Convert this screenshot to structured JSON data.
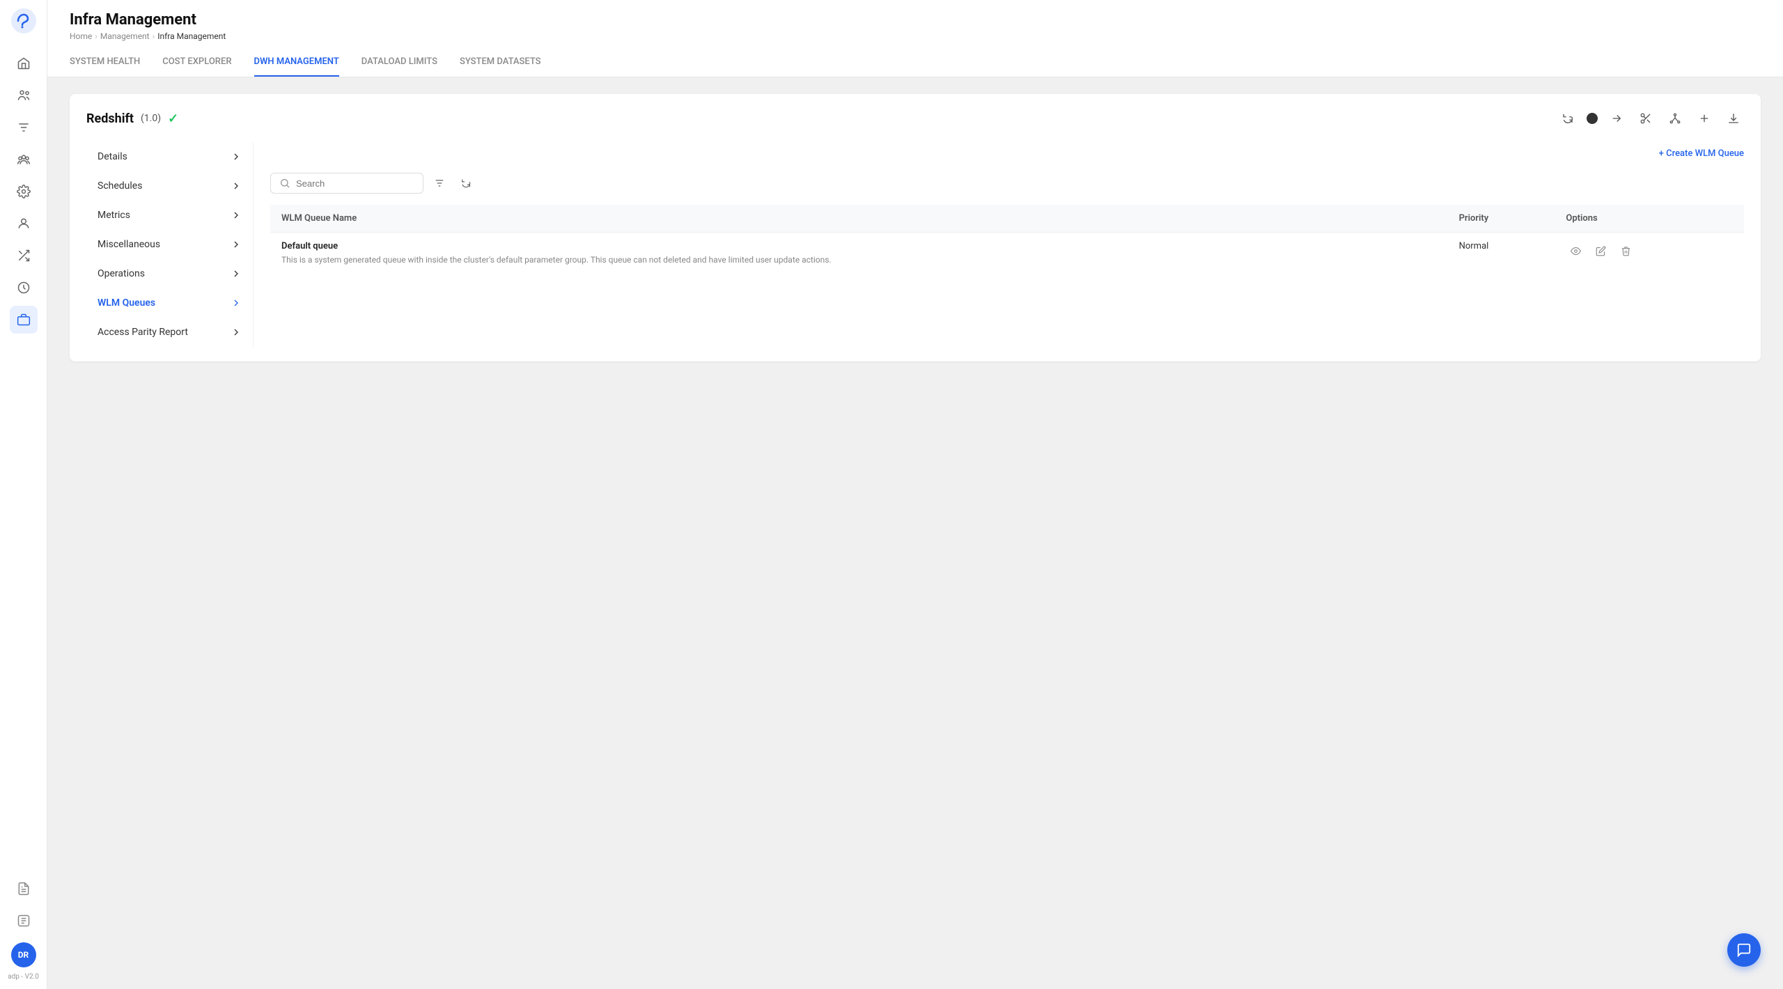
{
  "app": {
    "logo_alt": "App Logo",
    "version_label": "adp - V2.0"
  },
  "header": {
    "title": "Infra Management",
    "breadcrumb": [
      "Home",
      "Management",
      "Infra Management"
    ],
    "tabs": [
      {
        "label": "SYSTEM HEALTH",
        "active": false
      },
      {
        "label": "COST EXPLORER",
        "active": false
      },
      {
        "label": "DWH MANAGEMENT",
        "active": true
      },
      {
        "label": "DATALOAD LIMITS",
        "active": false
      },
      {
        "label": "SYSTEM DATASETS",
        "active": false
      }
    ]
  },
  "card": {
    "title": "Redshift",
    "version": "(1.0)",
    "check_symbol": "✓"
  },
  "left_nav": {
    "items": [
      {
        "label": "Details",
        "active": false
      },
      {
        "label": "Schedules",
        "active": false
      },
      {
        "label": "Metrics",
        "active": false
      },
      {
        "label": "Miscellaneous",
        "active": false
      },
      {
        "label": "Operations",
        "active": false
      },
      {
        "label": "WLM Queues",
        "active": true
      },
      {
        "label": "Access Parity Report",
        "active": false
      }
    ]
  },
  "wlm_queues": {
    "create_btn_label": "+ Create WLM Queue",
    "search_placeholder": "Search",
    "table": {
      "columns": [
        "WLM Queue Name",
        "Priority",
        "Options"
      ],
      "rows": [
        {
          "name": "Default queue",
          "description": "This is a system generated queue with inside the cluster's default parameter group. This queue can not deleted and have limited user update actions.",
          "priority": "Normal"
        }
      ]
    }
  },
  "sidebar": {
    "avatar_initials": "DR",
    "icons": [
      "home-icon",
      "users-icon",
      "filter-icon",
      "group-icon",
      "settings-icon",
      "person-icon",
      "shuffle-icon",
      "clock-icon",
      "briefcase-icon",
      "document-icon",
      "ai-icon"
    ]
  },
  "chat_fab_label": "Chat support"
}
